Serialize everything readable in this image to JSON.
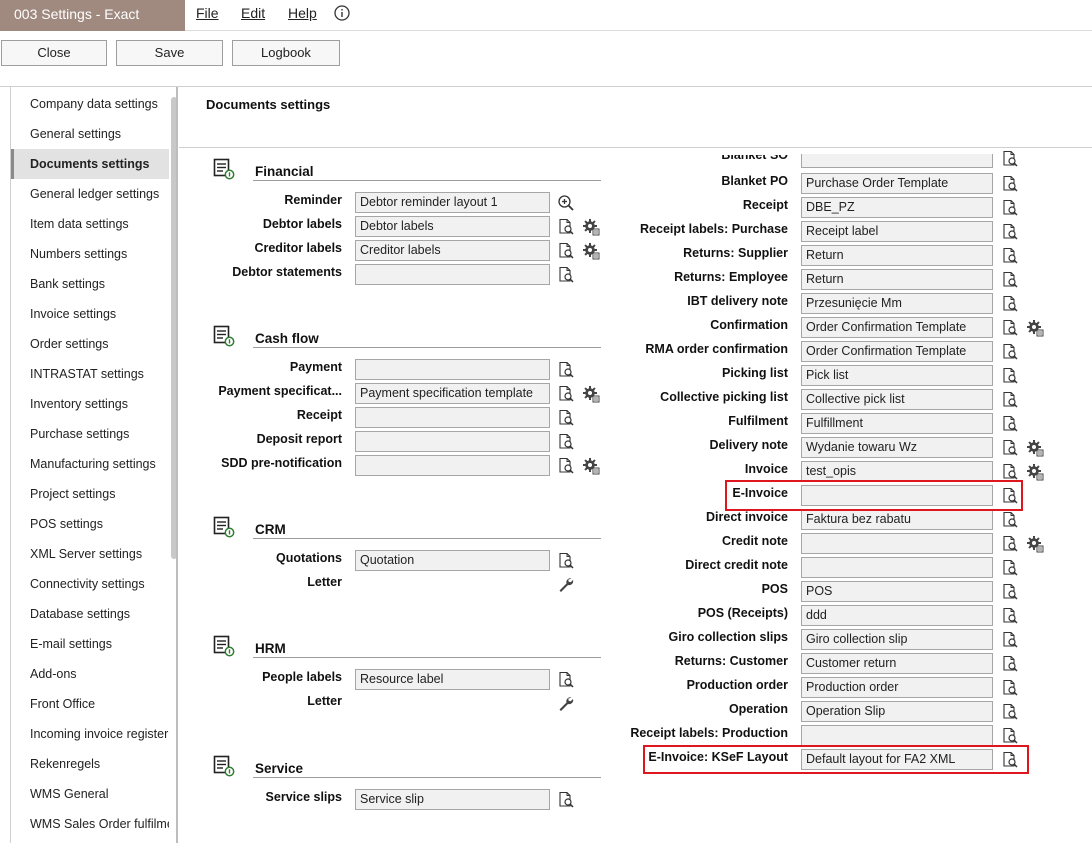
{
  "window": {
    "title": "003 Settings - Exact"
  },
  "menu": {
    "file": "File",
    "edit": "Edit",
    "help": "Help"
  },
  "toolbar": {
    "close": "Close",
    "save": "Save",
    "logbook": "Logbook"
  },
  "sidebar": {
    "items": [
      "Company data settings",
      "General settings",
      "Documents settings",
      "General ledger settings",
      "Item data settings",
      "Numbers settings",
      "Bank settings",
      "Invoice settings",
      "Order settings",
      "INTRASTAT settings",
      "Inventory settings",
      "Purchase settings",
      "Manufacturing settings",
      "Project settings",
      "POS settings",
      "XML Server settings",
      "Connectivity settings",
      "Database settings",
      "E-mail settings",
      "Add-ons",
      "Front Office",
      "Incoming invoice register",
      "Rekenregels",
      "WMS General",
      "WMS Sales Order fulfilme"
    ],
    "active": "Documents settings"
  },
  "page": {
    "title": "Documents settings"
  },
  "left": {
    "financial": {
      "title": "Financial",
      "rows": [
        {
          "label": "Reminder",
          "value": "Debtor reminder layout 1"
        },
        {
          "label": "Debtor labels",
          "value": "Debtor labels"
        },
        {
          "label": "Creditor labels",
          "value": "Creditor labels"
        },
        {
          "label": "Debtor statements",
          "value": ""
        }
      ]
    },
    "cashflow": {
      "title": "Cash flow",
      "rows": [
        {
          "label": "Payment",
          "value": ""
        },
        {
          "label": "Payment specificat...",
          "value": "Payment specification template"
        },
        {
          "label": "Receipt",
          "value": ""
        },
        {
          "label": "Deposit report",
          "value": ""
        },
        {
          "label": "SDD pre-notification",
          "value": ""
        }
      ]
    },
    "crm": {
      "title": "CRM",
      "rows": [
        {
          "label": "Quotations",
          "value": "Quotation"
        },
        {
          "label": "Letter",
          "value": ""
        }
      ]
    },
    "hrm": {
      "title": "HRM",
      "rows": [
        {
          "label": "People labels",
          "value": "Resource label"
        },
        {
          "label": "Letter",
          "value": ""
        }
      ]
    },
    "service": {
      "title": "Service",
      "rows": [
        {
          "label": "Service slips",
          "value": "Service slip"
        }
      ]
    }
  },
  "right": {
    "partial_top": {
      "label": "Blanket SO"
    },
    "rows": [
      {
        "label": "Blanket PO",
        "value": "Purchase Order Template"
      },
      {
        "label": "Receipt",
        "value": "DBE_PZ"
      },
      {
        "label": "Receipt labels: Purchase",
        "value": "Receipt label"
      },
      {
        "label": "Returns: Supplier",
        "value": "Return"
      },
      {
        "label": "Returns: Employee",
        "value": "Return"
      },
      {
        "label": "IBT delivery note",
        "value": "Przesunięcie Mm"
      },
      {
        "label": "Confirmation",
        "value": "Order Confirmation Template"
      },
      {
        "label": "RMA order confirmation",
        "value": "Order Confirmation Template"
      },
      {
        "label": "Picking list",
        "value": "Pick list"
      },
      {
        "label": "Collective picking list",
        "value": "Collective pick list"
      },
      {
        "label": "Fulfilment",
        "value": "Fulfillment"
      },
      {
        "label": "Delivery note",
        "value": "Wydanie towaru Wz"
      },
      {
        "label": "Invoice",
        "value": "test_opis"
      },
      {
        "label": "E-Invoice",
        "value": ""
      },
      {
        "label": "Direct invoice",
        "value": "Faktura bez rabatu"
      },
      {
        "label": "Credit note",
        "value": ""
      },
      {
        "label": "Direct credit note",
        "value": ""
      },
      {
        "label": "POS",
        "value": "POS"
      },
      {
        "label": "POS (Receipts)",
        "value": "ddd"
      },
      {
        "label": "Giro collection slips",
        "value": "Giro collection slip"
      },
      {
        "label": "Returns: Customer",
        "value": "Customer return"
      },
      {
        "label": "Production order",
        "value": "Production order"
      },
      {
        "label": "Operation",
        "value": "Operation Slip"
      },
      {
        "label": "Receipt labels: Production",
        "value": ""
      },
      {
        "label": "E-Invoice: KSeF Layout",
        "value": "Default layout for FA2 XML"
      }
    ]
  },
  "colors": {
    "title_bar": "#a08a80",
    "highlight": "#e0161e"
  }
}
